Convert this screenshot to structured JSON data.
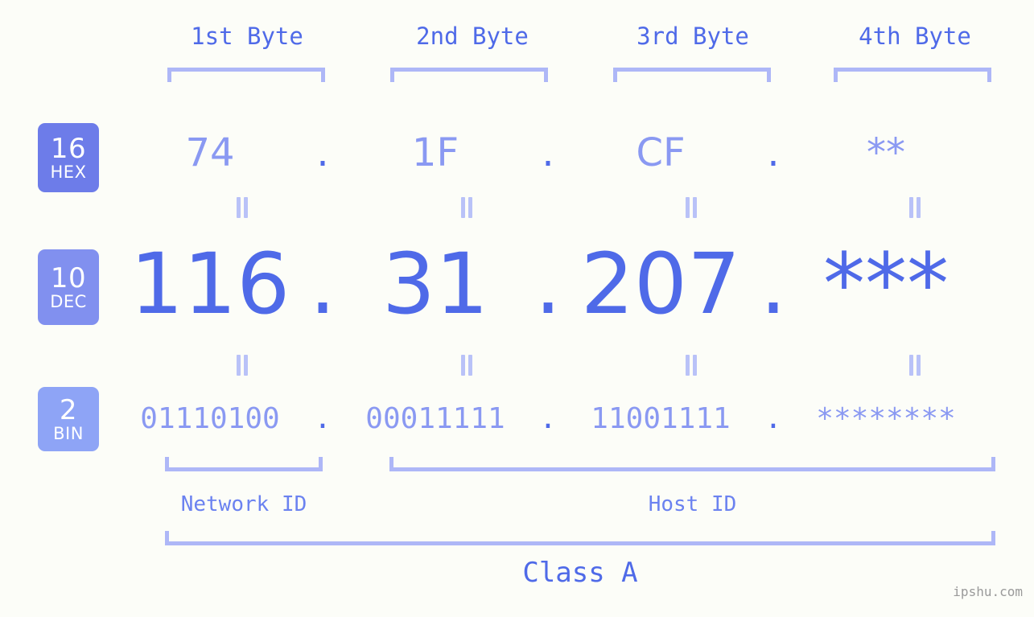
{
  "site": {
    "watermark": "ipshu.com"
  },
  "header": {
    "byte_labels": [
      {
        "label": "1st Byte"
      },
      {
        "label": "2nd Byte"
      },
      {
        "label": "3rd Byte"
      },
      {
        "label": "4th Byte"
      }
    ]
  },
  "bases": [
    {
      "id": "hex",
      "number": "16",
      "name": "HEX",
      "color": "#6d7ce9"
    },
    {
      "id": "dec",
      "number": "10",
      "name": "DEC",
      "color": "#8190ef"
    },
    {
      "id": "bin",
      "number": "2",
      "name": "BIN",
      "color": "#8ea4f6"
    }
  ],
  "separator": ".",
  "rows": {
    "hex": {
      "bytes": [
        "74",
        "1F",
        "CF",
        "**"
      ]
    },
    "dec": {
      "bytes": [
        "116",
        "31",
        "207",
        "***"
      ]
    },
    "bin": {
      "bytes": [
        "01110100",
        "00011111",
        "11001111",
        "********"
      ]
    }
  },
  "segments": {
    "network_id": "Network ID",
    "host_id": "Host ID",
    "class": "Class A"
  },
  "colors": {
    "background": "#fcfdf8",
    "accent_strong": "#4f6ae8",
    "accent_light": "#8a99f2",
    "bracket": "#aeb7f7",
    "equals": "#b9c2f8",
    "watermark": "#9a9a9a"
  }
}
